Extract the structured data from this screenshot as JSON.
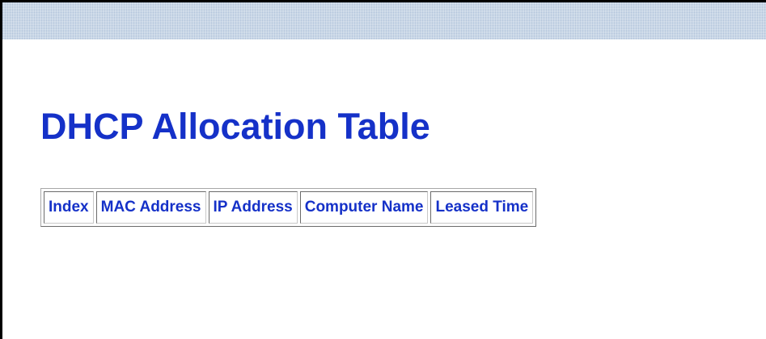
{
  "page": {
    "title": "DHCP Allocation Table"
  },
  "table": {
    "headers": [
      "Index",
      "MAC Address",
      "IP Address",
      "Computer Name",
      "Leased Time"
    ],
    "rows": []
  },
  "colors": {
    "accent": "#1531c8",
    "banner": "#c3d2e4"
  }
}
